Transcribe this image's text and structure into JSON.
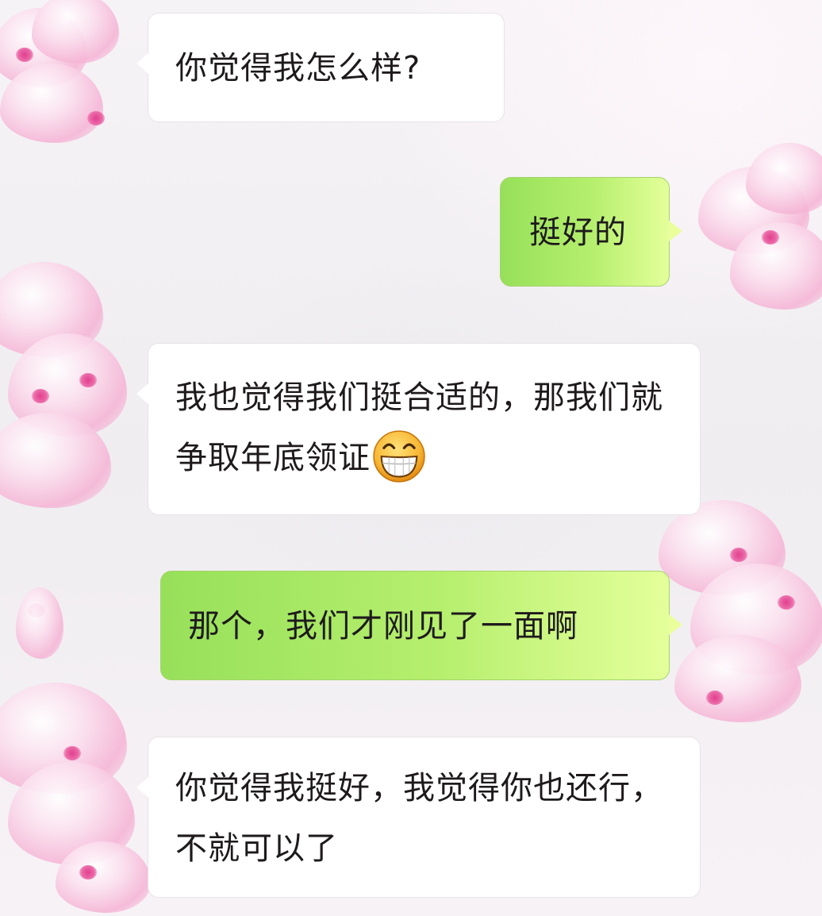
{
  "chat": {
    "messages": [
      {
        "side": "incoming",
        "text": "你觉得我怎么样?"
      },
      {
        "side": "outgoing",
        "text": "挺好的"
      },
      {
        "side": "incoming",
        "text": "我也觉得我们挺合适的，那我们就争取年底领证",
        "emoji": "grinning-face-emoji"
      },
      {
        "side": "outgoing",
        "text": "那个，我们才刚见了一面啊"
      },
      {
        "side": "incoming",
        "text": "你觉得我挺好，我觉得你也还行，不就可以了"
      }
    ]
  },
  "colors": {
    "incoming_bubble": "#ffffff",
    "outgoing_bubble_start": "#97e05a",
    "outgoing_bubble_end": "#e4ff9a",
    "text": "#1e1a1c",
    "blossom_pink": "#f5b5d6",
    "blossom_center": "#e23f8f"
  }
}
